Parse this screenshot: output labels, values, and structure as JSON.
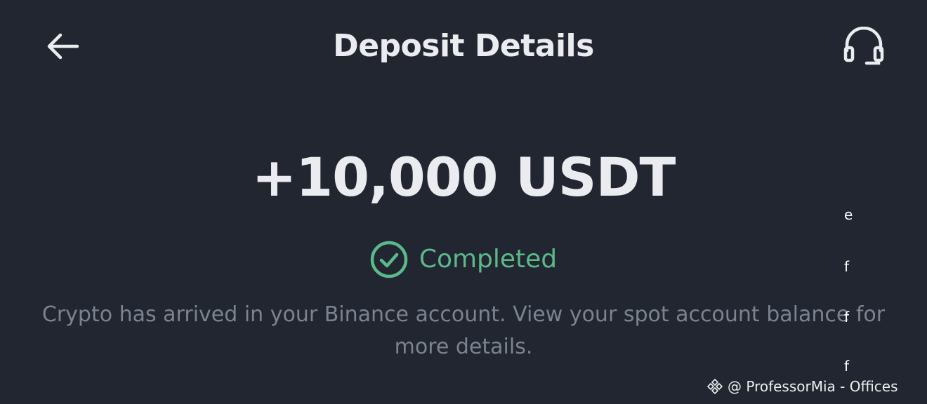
{
  "header": {
    "title": "Deposit Details",
    "back_icon": "arrow-left-icon",
    "support_icon": "headset-icon"
  },
  "deposit": {
    "amount": "+10,000 USDT",
    "status": "Completed",
    "status_icon": "check-circle-icon",
    "description": "Crypto has arrived in your Binance account. View your spot account balance for more details."
  },
  "overlay": {
    "letters": [
      "e",
      "f",
      "f",
      "f"
    ],
    "watermark_text": "@ ProfessorMia - Offices",
    "watermark_logo": "binance-logo-icon"
  },
  "colors": {
    "background": "#212630",
    "text_primary": "#EAECEF",
    "text_secondary": "#7B8390",
    "success": "#5BB98B"
  }
}
